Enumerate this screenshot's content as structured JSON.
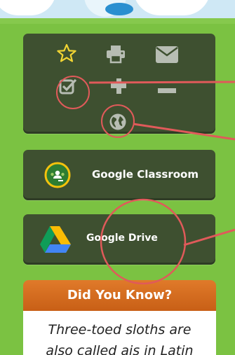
{
  "share_panel": {
    "icons": [
      "star-icon",
      "print-icon",
      "email-icon",
      "checkbox-icon",
      "plus-icon",
      "minus-icon",
      "globe-icon"
    ]
  },
  "classroom_button": {
    "label": "Google Classroom",
    "icon": "google-classroom-icon"
  },
  "drive_button": {
    "label": "Google Drive",
    "icon": "google-drive-icon"
  },
  "did_you_know": {
    "title": "Did You Know?",
    "lines": [
      "Three-toed sloths are",
      "also called ais in Latin"
    ]
  },
  "colors": {
    "background": "#7bc242",
    "panel": "#3e5030",
    "icon_gray": "#b7bdb3",
    "star": "#f3d533",
    "annotation": "#e05a5a",
    "header_orange": "#d8701f"
  }
}
